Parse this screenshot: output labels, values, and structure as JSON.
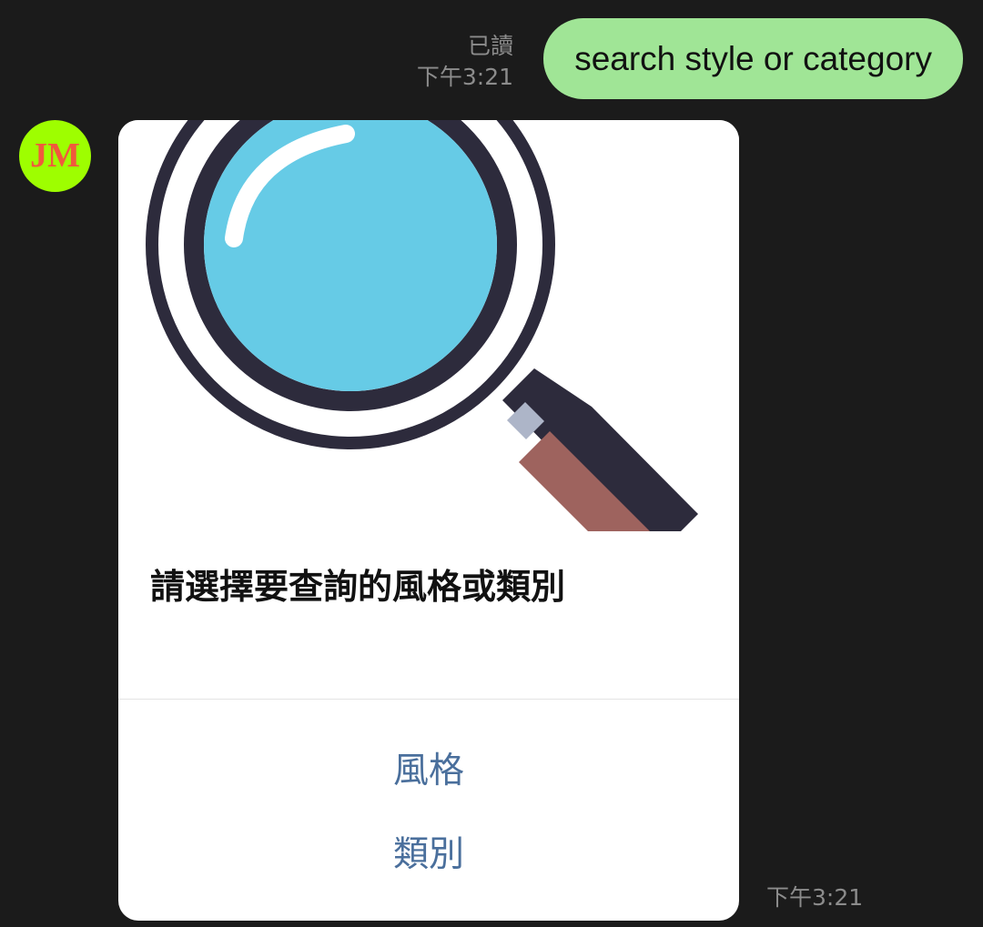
{
  "chat": {
    "outgoing": {
      "read_status": "已讀",
      "time": "下午3:21",
      "text": "search style or category"
    },
    "incoming": {
      "avatar": {
        "initials": "JM",
        "bg_color": "#9efe00",
        "text_color": "#f05a3c"
      },
      "card": {
        "image_icon": "magnifier-icon",
        "title": "請選擇要查詢的風格或類別",
        "actions": [
          {
            "label": "風格"
          },
          {
            "label": "類別"
          }
        ],
        "action_color": "#4a6f9c"
      },
      "time": "下午3:21"
    }
  },
  "colors": {
    "background": "#1b1b1b",
    "outgoing_bubble": "#a0e596",
    "meta_text": "#8c8c8c"
  }
}
